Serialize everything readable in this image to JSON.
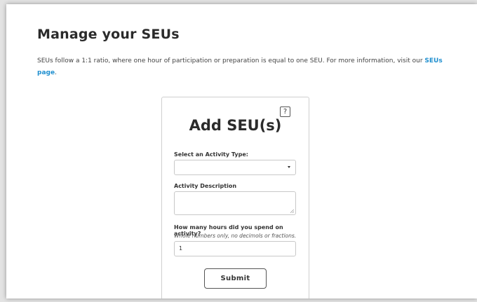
{
  "page": {
    "title": "Manage your SEUs",
    "intro_text": "SEUs follow a 1:1 ratio, where one hour of participation or preparation is equal to one SEU. For more information, visit our ",
    "intro_link": "SEUs page",
    "intro_end": "."
  },
  "form": {
    "help_icon": "?",
    "title": "Add SEU(s)",
    "activity_type": {
      "label": "Select an Activity Type:",
      "value": ""
    },
    "description": {
      "label": "Activity Description",
      "value": ""
    },
    "hours": {
      "label": "How many hours did you spend on activity?",
      "hint": "Whole numbers only, no decimols or fractions.",
      "value": "1"
    },
    "submit_label": "Submit"
  },
  "icons": {
    "help": "question-mark-icon",
    "dropdown": "chevron-down-icon",
    "resize": "resize-handle-icon"
  },
  "colors": {
    "link": "#1f8fcf",
    "background": "#ffffff",
    "border": "#c8c8c8"
  }
}
